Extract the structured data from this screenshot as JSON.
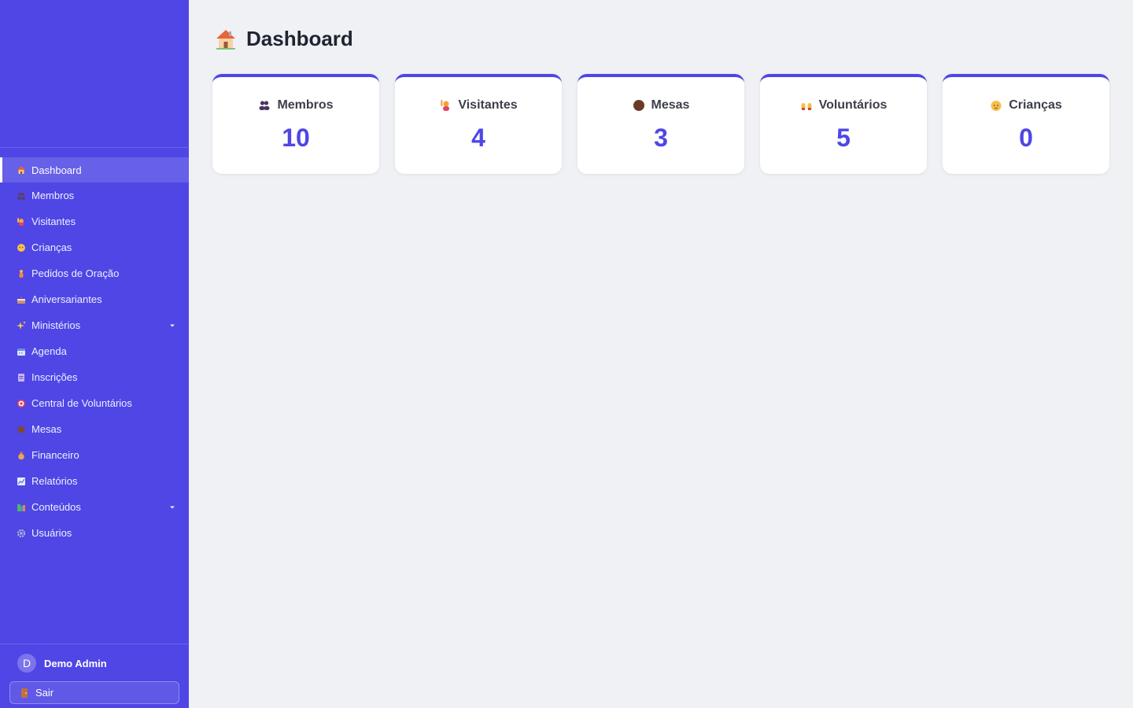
{
  "page": {
    "title": "Dashboard",
    "title_icon": "house-icon"
  },
  "colors": {
    "accent": "#4f46e5",
    "background": "#f0f1f5",
    "card_bg": "#ffffff",
    "title_text": "#1f2430"
  },
  "sidebar": {
    "items": [
      {
        "label": "Dashboard",
        "icon": "house-icon",
        "active": true
      },
      {
        "label": "Membros",
        "icon": "people-icon"
      },
      {
        "label": "Visitantes",
        "icon": "raising-hand-icon"
      },
      {
        "label": "Crianças",
        "icon": "child-icon"
      },
      {
        "label": "Pedidos de Oração",
        "icon": "praying-person-icon"
      },
      {
        "label": "Aniversariantes",
        "icon": "birthday-cake-icon"
      },
      {
        "label": "Ministérios",
        "icon": "sparkles-icon",
        "expandable": true
      },
      {
        "label": "Agenda",
        "icon": "calendar-icon"
      },
      {
        "label": "Inscrições",
        "icon": "clipboard-icon"
      },
      {
        "label": "Central de Voluntários",
        "icon": "target-icon"
      },
      {
        "label": "Mesas",
        "icon": "table-icon"
      },
      {
        "label": "Financeiro",
        "icon": "money-bag-icon"
      },
      {
        "label": "Relatórios",
        "icon": "chart-icon"
      },
      {
        "label": "Conteúdos",
        "icon": "books-icon",
        "expandable": true
      },
      {
        "label": "Usuários",
        "icon": "gear-icon"
      }
    ],
    "user": {
      "initial": "D",
      "name": "Demo Admin"
    },
    "logout": {
      "label": "Sair",
      "icon": "door-icon"
    }
  },
  "cards": [
    {
      "label": "Membros",
      "value": "10",
      "icon": "people-icon"
    },
    {
      "label": "Visitantes",
      "value": "4",
      "icon": "raising-hand-icon"
    },
    {
      "label": "Mesas",
      "value": "3",
      "icon": "brown-circle-icon"
    },
    {
      "label": "Voluntários",
      "value": "5",
      "icon": "raised-hands-icon"
    },
    {
      "label": "Crianças",
      "value": "0",
      "icon": "child-icon"
    }
  ]
}
